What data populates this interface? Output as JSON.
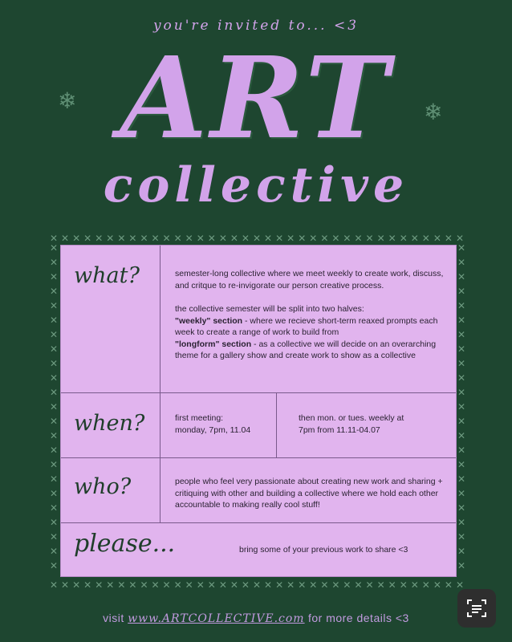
{
  "header": {
    "invited": "you're invited to... <3",
    "title": "ART",
    "subtitle": "collective"
  },
  "sections": {
    "what": {
      "label": "what?",
      "p1": "semester-long collective where we meet weekly to create work, discuss, and critque to re-invigorate our person creative process.",
      "p2": "the collective semester will be split into two halves:",
      "weekly_label": "\"weekly\" section",
      "weekly_text": " - where we recieve short-term reaxed prompts each week to create a range of work to build from",
      "longform_label": "\"longform\" section",
      "longform_text": " - as a collective we will decide on an overarching theme for a gallery show and create work to show as a collective"
    },
    "when": {
      "label": "when?",
      "first_line1": "first meeting:",
      "first_line2": "monday, 7pm, 11.04",
      "then_line1": "then mon. or tues. weekly at",
      "then_line2": "7pm from 11.11-04.07"
    },
    "who": {
      "label": "who?",
      "text": "people who feel very passionate about creating new work and sharing + critiquing with other and building a collective where we hold each other accountable to making really cool stuff!"
    },
    "please": {
      "label": "please...",
      "note": "bring some of your previous work to share <3"
    }
  },
  "footer": {
    "visit": "visit",
    "url": "www.ARTCOLLECTIVE.com",
    "more": "for more details <3"
  },
  "icons": {
    "snowflake": "snowflake-icon",
    "scan": "scan-text-icon"
  },
  "colors": {
    "background": "#1e4630",
    "accent": "#d2a3ea",
    "panel": "#e1b4ee"
  }
}
